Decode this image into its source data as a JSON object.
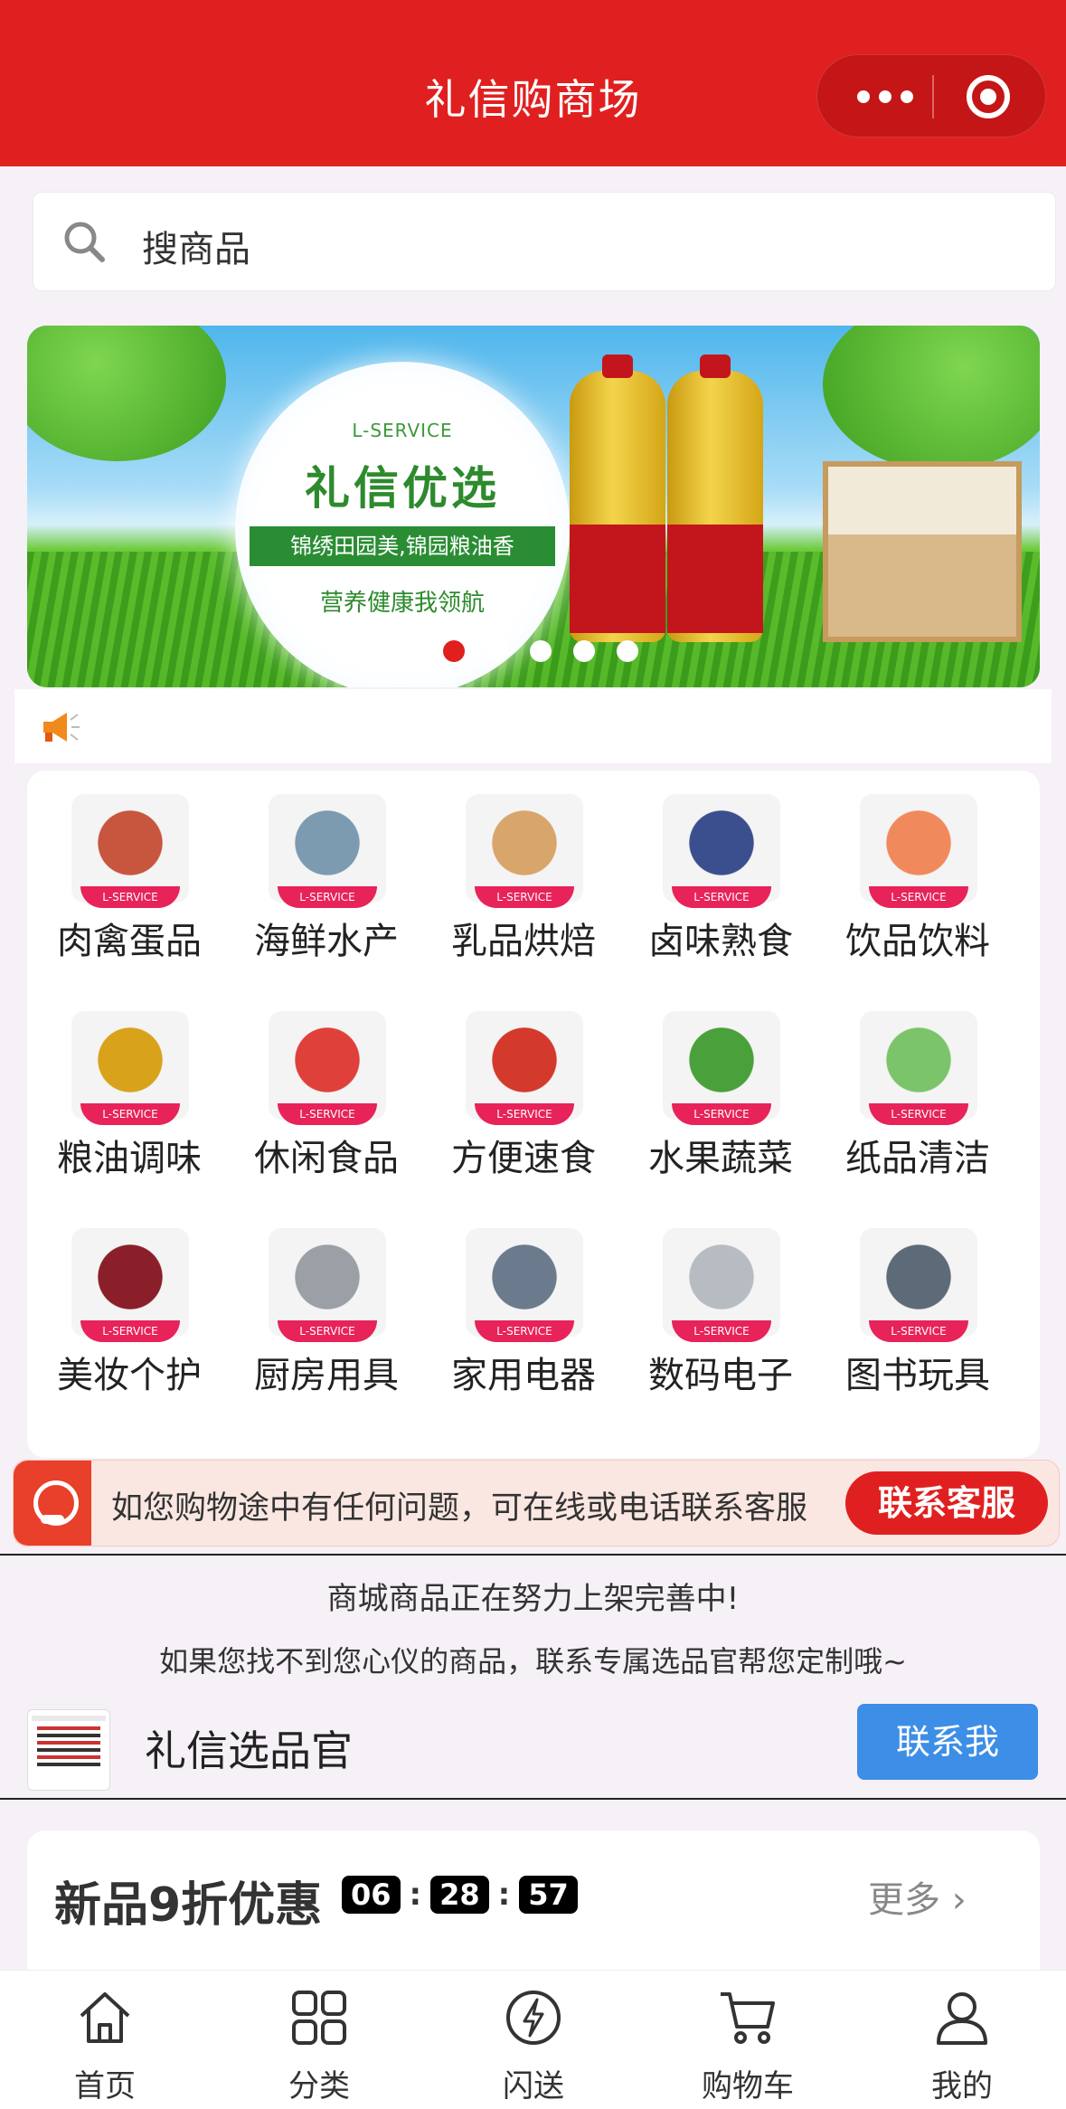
{
  "header": {
    "title": "礼信购商场",
    "bg_color": "#e02020"
  },
  "search": {
    "placeholder": "搜商品"
  },
  "banner": {
    "brand_en": "L-SERVICE",
    "brand_cn": "礼信优选",
    "ribbon": "锦绣田园美,锦园粮油香",
    "slogan": "营养健康我领航",
    "slide_count": 5,
    "active_slide": 1
  },
  "categories": [
    {
      "label": "肉禽蛋品",
      "icon": "meat-egg-icon",
      "color": "#c8553d"
    },
    {
      "label": "海鲜水产",
      "icon": "seafood-icon",
      "color": "#7c9bb0"
    },
    {
      "label": "乳品烘焙",
      "icon": "bakery-icon",
      "color": "#d8a56a"
    },
    {
      "label": "卤味熟食",
      "icon": "deli-icon",
      "color": "#3b4f8f"
    },
    {
      "label": "饮品饮料",
      "icon": "beverage-icon",
      "color": "#f08a5d"
    },
    {
      "label": "粮油调味",
      "icon": "oil-seasoning-icon",
      "color": "#d9a21b"
    },
    {
      "label": "休闲食品",
      "icon": "snack-icon",
      "color": "#e0403a"
    },
    {
      "label": "方便速食",
      "icon": "instant-food-icon",
      "color": "#d33a2c"
    },
    {
      "label": "水果蔬菜",
      "icon": "fruit-vegetable-icon",
      "color": "#4aa03a"
    },
    {
      "label": "纸品清洁",
      "icon": "tissue-icon",
      "color": "#7cc46a"
    },
    {
      "label": "美妆个护",
      "icon": "cosmetics-icon",
      "color": "#8a1f2a"
    },
    {
      "label": "厨房用具",
      "icon": "kitchen-knife-icon",
      "color": "#9aa0a6"
    },
    {
      "label": "家用电器",
      "icon": "appliance-icon",
      "color": "#6b7a8c"
    },
    {
      "label": "数码电子",
      "icon": "digital-device-icon",
      "color": "#b7bcc2"
    },
    {
      "label": "图书玩具",
      "icon": "toy-robot-icon",
      "color": "#5d6b78"
    }
  ],
  "category_tag": "L-SERVICE",
  "service": {
    "text": "如您购物途中有任何问题，可在线或电话联系客服",
    "button": "联系客服"
  },
  "info": {
    "line1": "商城商品正在努力上架完善中!",
    "line2": "如果您找不到您心仪的商品，联系专属选品官帮您定制哦~",
    "officer_name": "礼信选品官",
    "contact_button": "联系我"
  },
  "new_products": {
    "title": "新品9折优惠",
    "timer": [
      "06",
      "28",
      "57"
    ],
    "more": "更多"
  },
  "tabbar": [
    {
      "label": "首页",
      "icon": "home-icon"
    },
    {
      "label": "分类",
      "icon": "category-icon"
    },
    {
      "label": "闪送",
      "icon": "flash-icon"
    },
    {
      "label": "购物车",
      "icon": "cart-icon"
    },
    {
      "label": "我的",
      "icon": "user-icon"
    }
  ]
}
